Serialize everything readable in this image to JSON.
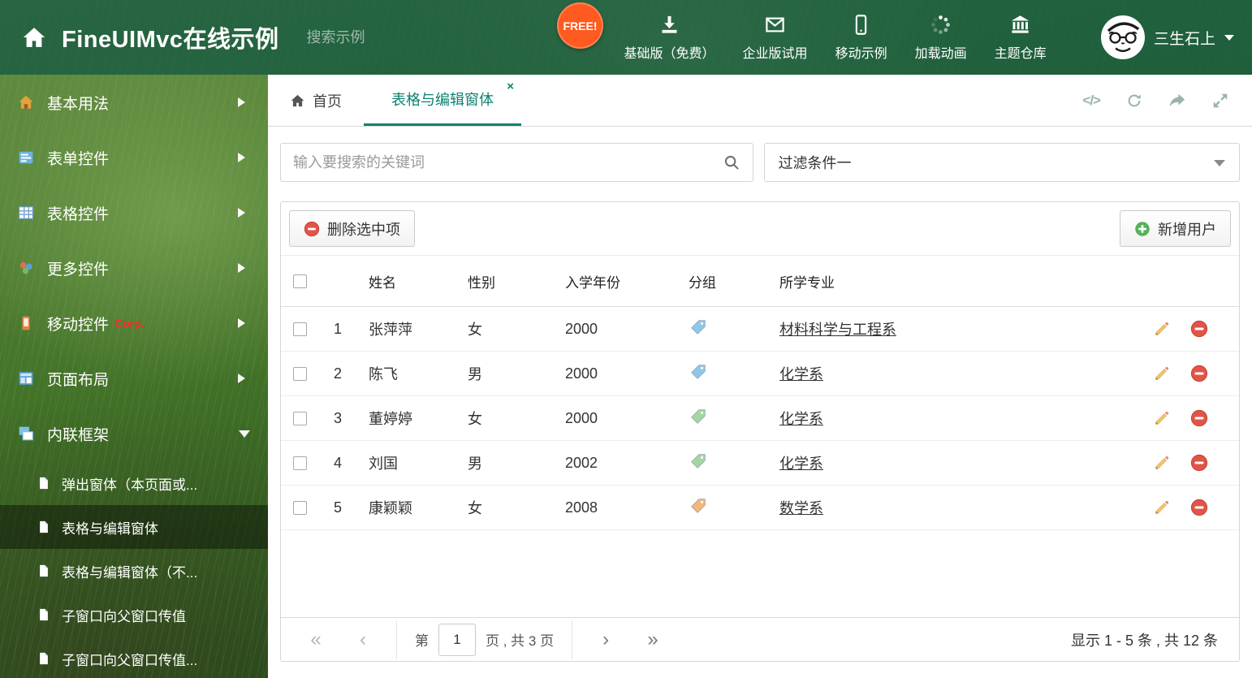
{
  "header": {
    "title": "FineUIMvc在线示例",
    "search_placeholder": "搜索示例",
    "free_badge": "FREE!",
    "nav_items": [
      {
        "label": "基础版（免费）"
      },
      {
        "label": "企业版试用"
      },
      {
        "label": "移动示例"
      },
      {
        "label": "加载动画"
      },
      {
        "label": "主题仓库"
      }
    ],
    "user_name": "三生石上"
  },
  "sidebar": {
    "items": [
      {
        "label": "基本用法"
      },
      {
        "label": "表单控件"
      },
      {
        "label": "表格控件"
      },
      {
        "label": "更多控件"
      },
      {
        "label": "移动控件",
        "badge": "Corp."
      },
      {
        "label": "页面布局"
      },
      {
        "label": "内联框架"
      }
    ],
    "subitems": [
      {
        "label": "弹出窗体（本页面或..."
      },
      {
        "label": "表格与编辑窗体"
      },
      {
        "label": "表格与编辑窗体（不..."
      },
      {
        "label": "子窗口向父窗口传值"
      },
      {
        "label": "子窗口向父窗口传值..."
      }
    ]
  },
  "tabs": {
    "home_label": "首页",
    "active_label": "表格与编辑窗体",
    "close_icon": "×"
  },
  "icons": {
    "code": "</>"
  },
  "search": {
    "placeholder": "输入要搜索的关键词"
  },
  "filter": {
    "selected": "过滤条件一"
  },
  "toolbar": {
    "delete_label": "删除选中项",
    "add_label": "新增用户"
  },
  "table": {
    "columns": {
      "name": "姓名",
      "gender": "性别",
      "year": "入学年份",
      "group": "分组",
      "major": "所学专业"
    },
    "rows": [
      {
        "index": "1",
        "name": "张萍萍",
        "gender": "女",
        "year": "2000",
        "tag_color": "#8fc7ea",
        "major": "材料科学与工程系"
      },
      {
        "index": "2",
        "name": "陈飞",
        "gender": "男",
        "year": "2000",
        "tag_color": "#8fc7ea",
        "major": "化学系"
      },
      {
        "index": "3",
        "name": "董婷婷",
        "gender": "女",
        "year": "2000",
        "tag_color": "#a5d6a0",
        "major": "化学系"
      },
      {
        "index": "4",
        "name": "刘国",
        "gender": "男",
        "year": "2002",
        "tag_color": "#a5d6a0",
        "major": "化学系"
      },
      {
        "index": "5",
        "name": "康颖颖",
        "gender": "女",
        "year": "2008",
        "tag_color": "#f4b678",
        "major": "数学系"
      }
    ]
  },
  "pagination": {
    "first": "«",
    "prev": "‹",
    "next": "›",
    "last": "»",
    "page_prefix": "第",
    "current_page": "1",
    "page_suffix": "页 , 共 3 页",
    "summary": "显示 1 - 5 条 , 共 12 条"
  },
  "colors": {
    "accent": "#0b8270",
    "delete_red": "#e05548",
    "add_green": "#57b257"
  }
}
